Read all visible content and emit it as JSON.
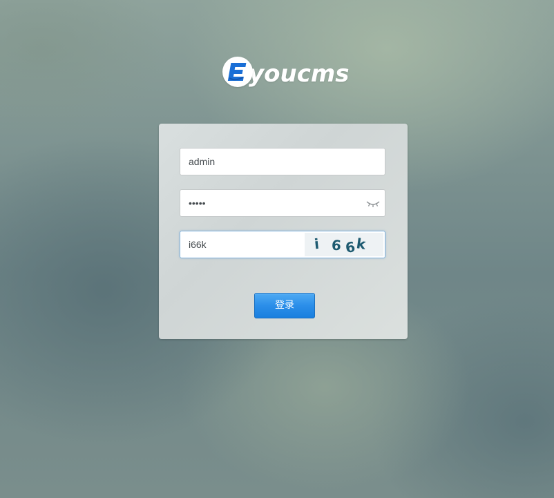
{
  "brand": {
    "name": "youcms",
    "badge_letter": "E",
    "badge_color": "#1a6fd6"
  },
  "login_form": {
    "username": {
      "value": "admin"
    },
    "password": {
      "value": "•••••",
      "toggle_icon": "eye-closed-icon"
    },
    "captcha": {
      "value": "i66k",
      "image_chars": [
        "i",
        "6",
        "6",
        "k"
      ]
    },
    "submit_label": "登录"
  },
  "colors": {
    "button": "#2b8ee9",
    "captcha_text": "#1d5a70",
    "focus_border": "#7fb1dc"
  }
}
